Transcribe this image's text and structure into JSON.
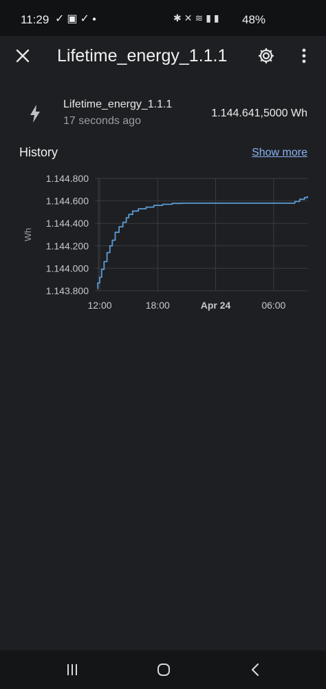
{
  "status_bar": {
    "time": "11:29",
    "left_icons": [
      "check-icon",
      "image-icon",
      "check-icon",
      "dot-icon"
    ],
    "right_icons": [
      "bluetooth-icon",
      "mute-icon",
      "wifi-icon",
      "signal-icon",
      "signal-icon"
    ],
    "battery": "48%"
  },
  "header": {
    "title": "Lifetime_energy_1.1.1",
    "close_icon": "close-icon",
    "settings_icon": "gear-icon",
    "more_icon": "more-vertical-icon"
  },
  "entity": {
    "icon": "lightning-bolt-icon",
    "name": "Lifetime_energy_1.1.1",
    "last_changed": "17 seconds ago",
    "value": "1.144.641,5000 Wh"
  },
  "history": {
    "title": "History",
    "show_more": "Show more"
  },
  "chart_data": {
    "type": "line",
    "ylabel": "Wh",
    "ylim": [
      1143800,
      1144800
    ],
    "y_ticks": [
      1143800,
      1144000,
      1144200,
      1144400,
      1144600,
      1144800
    ],
    "y_tick_labels": [
      "1.143.800",
      "1.144.000",
      "1.144.200",
      "1.144.400",
      "1.144.600",
      "1.144.800"
    ],
    "xlim": [
      11.5,
      33.5
    ],
    "x_ticks": [
      12,
      18,
      24,
      30
    ],
    "x_tick_labels": [
      "12:00",
      "18:00",
      "Apr 24",
      "06:00"
    ],
    "x_bold": [
      false,
      false,
      true,
      false
    ],
    "grid": true,
    "line_color": "#5b9bd5",
    "series": [
      {
        "points": [
          [
            11.75,
            1143820
          ],
          [
            11.8,
            1143870
          ],
          [
            12.0,
            1143920
          ],
          [
            12.2,
            1143990
          ],
          [
            12.45,
            1144060
          ],
          [
            12.75,
            1144140
          ],
          [
            13.05,
            1144200
          ],
          [
            13.3,
            1144250
          ],
          [
            13.6,
            1144320
          ],
          [
            14.0,
            1144370
          ],
          [
            14.4,
            1144410
          ],
          [
            14.75,
            1144450
          ],
          [
            15.0,
            1144480
          ],
          [
            15.4,
            1144510
          ],
          [
            16.0,
            1144530
          ],
          [
            16.8,
            1144545
          ],
          [
            17.6,
            1144560
          ],
          [
            18.5,
            1144570
          ],
          [
            19.5,
            1144578
          ],
          [
            20.5,
            1144580
          ],
          [
            24.0,
            1144580
          ],
          [
            28.0,
            1144580
          ],
          [
            31.5,
            1144580
          ],
          [
            32.2,
            1144595
          ],
          [
            32.7,
            1144615
          ],
          [
            33.2,
            1144630
          ],
          [
            33.5,
            1144641.5
          ]
        ]
      }
    ]
  }
}
